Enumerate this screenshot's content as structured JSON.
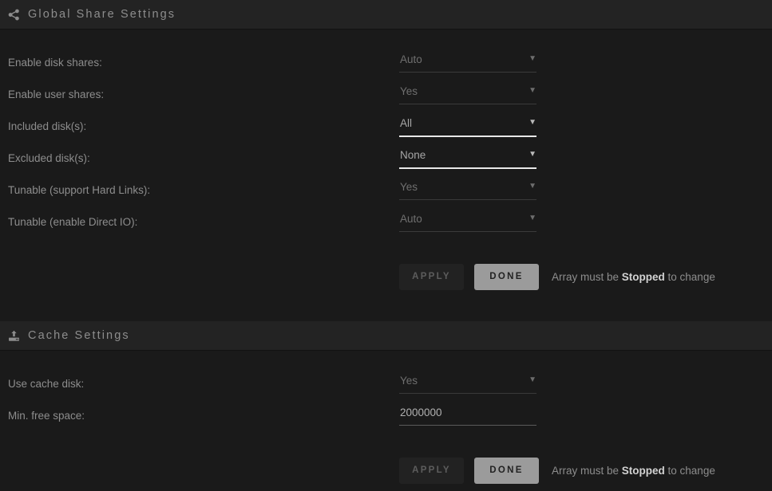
{
  "sections": [
    {
      "id": "global-share-settings",
      "icon": "share-alt-icon",
      "title": "Global Share Settings",
      "rows": [
        {
          "label": "Enable disk shares:",
          "type": "select",
          "value": "Auto",
          "enabled": false
        },
        {
          "label": "Enable user shares:",
          "type": "select",
          "value": "Yes",
          "enabled": false
        },
        {
          "label": "Included disk(s):",
          "type": "select",
          "value": "All",
          "enabled": true
        },
        {
          "label": "Excluded disk(s):",
          "type": "select",
          "value": "None",
          "enabled": true
        },
        {
          "label": "Tunable (support Hard Links):",
          "type": "select",
          "value": "Yes",
          "enabled": false
        },
        {
          "label": "Tunable (enable Direct IO):",
          "type": "select",
          "value": "Auto",
          "enabled": false
        }
      ],
      "actions": {
        "apply_label": "APPLY",
        "apply_disabled": true,
        "done_label": "DONE",
        "note_prefix": "Array must be ",
        "note_strong": "Stopped",
        "note_suffix": " to change"
      }
    },
    {
      "id": "cache-settings",
      "icon": "upload-icon",
      "title": "Cache Settings",
      "rows": [
        {
          "label": "Use cache disk:",
          "type": "select",
          "value": "Yes",
          "enabled": false
        },
        {
          "label": "Min. free space:",
          "type": "text",
          "value": "2000000",
          "placeholder": ""
        }
      ],
      "actions": {
        "apply_label": "APPLY",
        "apply_disabled": true,
        "done_label": "DONE",
        "note_prefix": "Array must be ",
        "note_strong": "Stopped",
        "note_suffix": " to change"
      }
    }
  ],
  "colors": {
    "page_background": "#1a1a1a",
    "header_background": "#232323",
    "label_text": "#8d8d8d",
    "disabled_value_text": "#6f6f6f",
    "enabled_value_text": "#a6a6a6",
    "enabled_underline": "#e8e8e8",
    "disabled_underline": "#3a3a3a",
    "done_button_background": "#9b9b9b",
    "apply_button_background": "#222222"
  }
}
